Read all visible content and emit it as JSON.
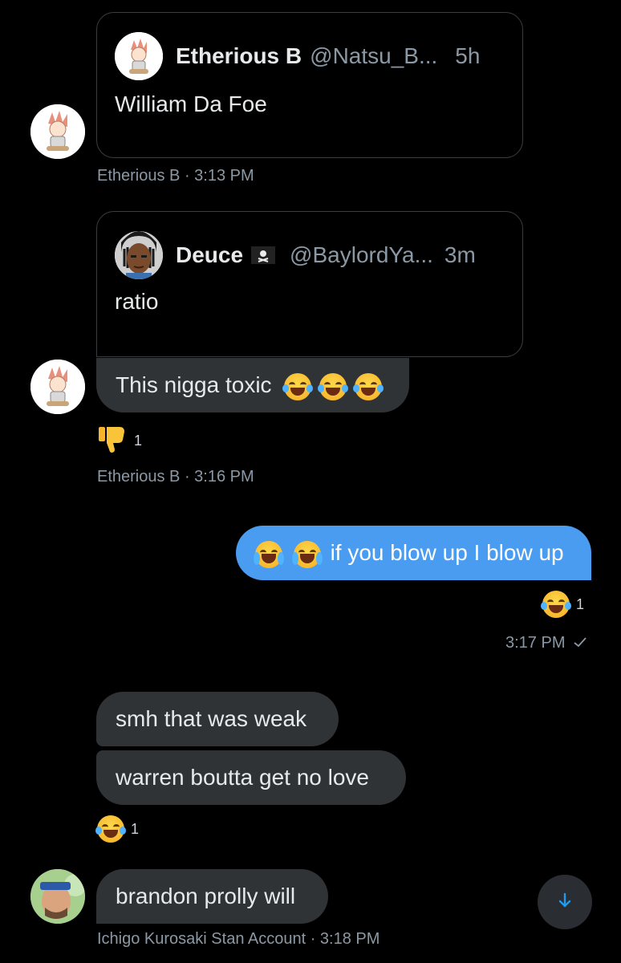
{
  "thread": {
    "quote1": {
      "name": "Etherious B",
      "handle": "@Natsu_B...",
      "time": "5h",
      "text": "William Da Foe"
    },
    "msg1_meta": "Etherious B · 3:13 PM",
    "quote2": {
      "name": "Deuce",
      "flag_emoji": "pirate-flag-icon",
      "handle": "@BaylordYa...",
      "time": "3m",
      "text": "ratio"
    },
    "msg2": {
      "text": "This nigga toxic"
    },
    "msg2_reaction": {
      "icon": "thumbs-down-icon",
      "count": "1"
    },
    "msg2_meta": "Etherious B · 3:16 PM",
    "msg3": {
      "text": "if you blow up I blow up"
    },
    "msg3_reaction": {
      "icon": "tears-of-joy-icon",
      "count": "1"
    },
    "msg3_meta": "3:17 PM",
    "msg4": {
      "text": "smh that was weak"
    },
    "msg5": {
      "text": "warren boutta get no love"
    },
    "msg5_reaction": {
      "icon": "tears-of-joy-icon",
      "count": "1"
    },
    "msg6": {
      "text": "brandon prolly will"
    },
    "msg6_meta": "Ichigo Kurosaki Stan Account · 3:18 PM"
  },
  "colors": {
    "background": "#000000",
    "incoming_bubble": "#2f3336",
    "outgoing_bubble": "#4a9cf0",
    "muted_text": "#8b98a5",
    "accent": "#1d9bf0"
  }
}
